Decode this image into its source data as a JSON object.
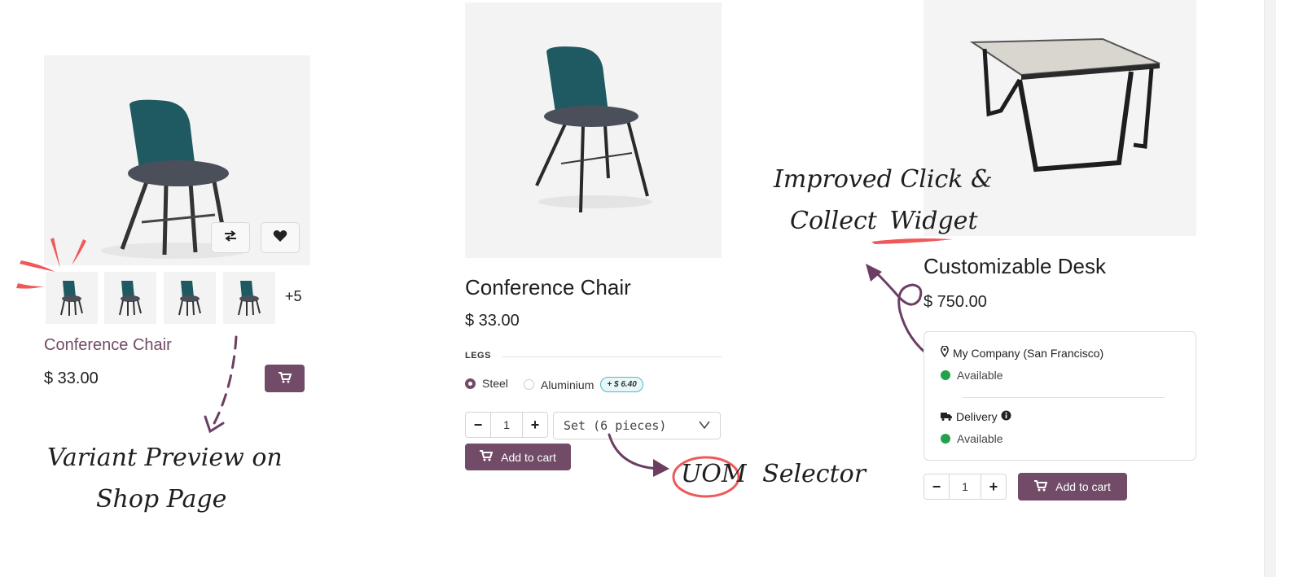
{
  "colors": {
    "accent": "#714b67",
    "available": "#22a24b",
    "annotation_red": "#ee5a5a"
  },
  "left_card": {
    "more_count": "+5",
    "name": "Conference Chair",
    "price": "$ 33.00",
    "compare_icon": "compare-arrows-icon",
    "wishlist_icon": "heart-icon",
    "cart_icon": "cart-icon"
  },
  "middle_card": {
    "name": "Conference Chair",
    "price": "$ 33.00",
    "attribute_label": "LEGS",
    "options": [
      {
        "label": "Steel",
        "selected": true
      },
      {
        "label": "Aluminium",
        "selected": false,
        "extra": "+ $ 6.40"
      }
    ],
    "quantity": "1",
    "uom": "Set (6 pieces)",
    "add_to_cart": "Add to cart"
  },
  "right_card": {
    "name": "Customizable Desk",
    "price": "$ 750.00",
    "store": "My Company (San Francisco)",
    "store_status": "Available",
    "delivery": "Delivery",
    "delivery_status": "Available",
    "quantity": "1",
    "add_to_cart": "Add to cart"
  },
  "annotations": {
    "variant_line1": "Variant Preview on",
    "variant_line2": "Shop Page",
    "uom_word1": "UOM",
    "uom_word2": "Selector",
    "click_line1": "Improved Click &",
    "click_line2_a": "Collect",
    "click_line2_b": "Widget"
  }
}
